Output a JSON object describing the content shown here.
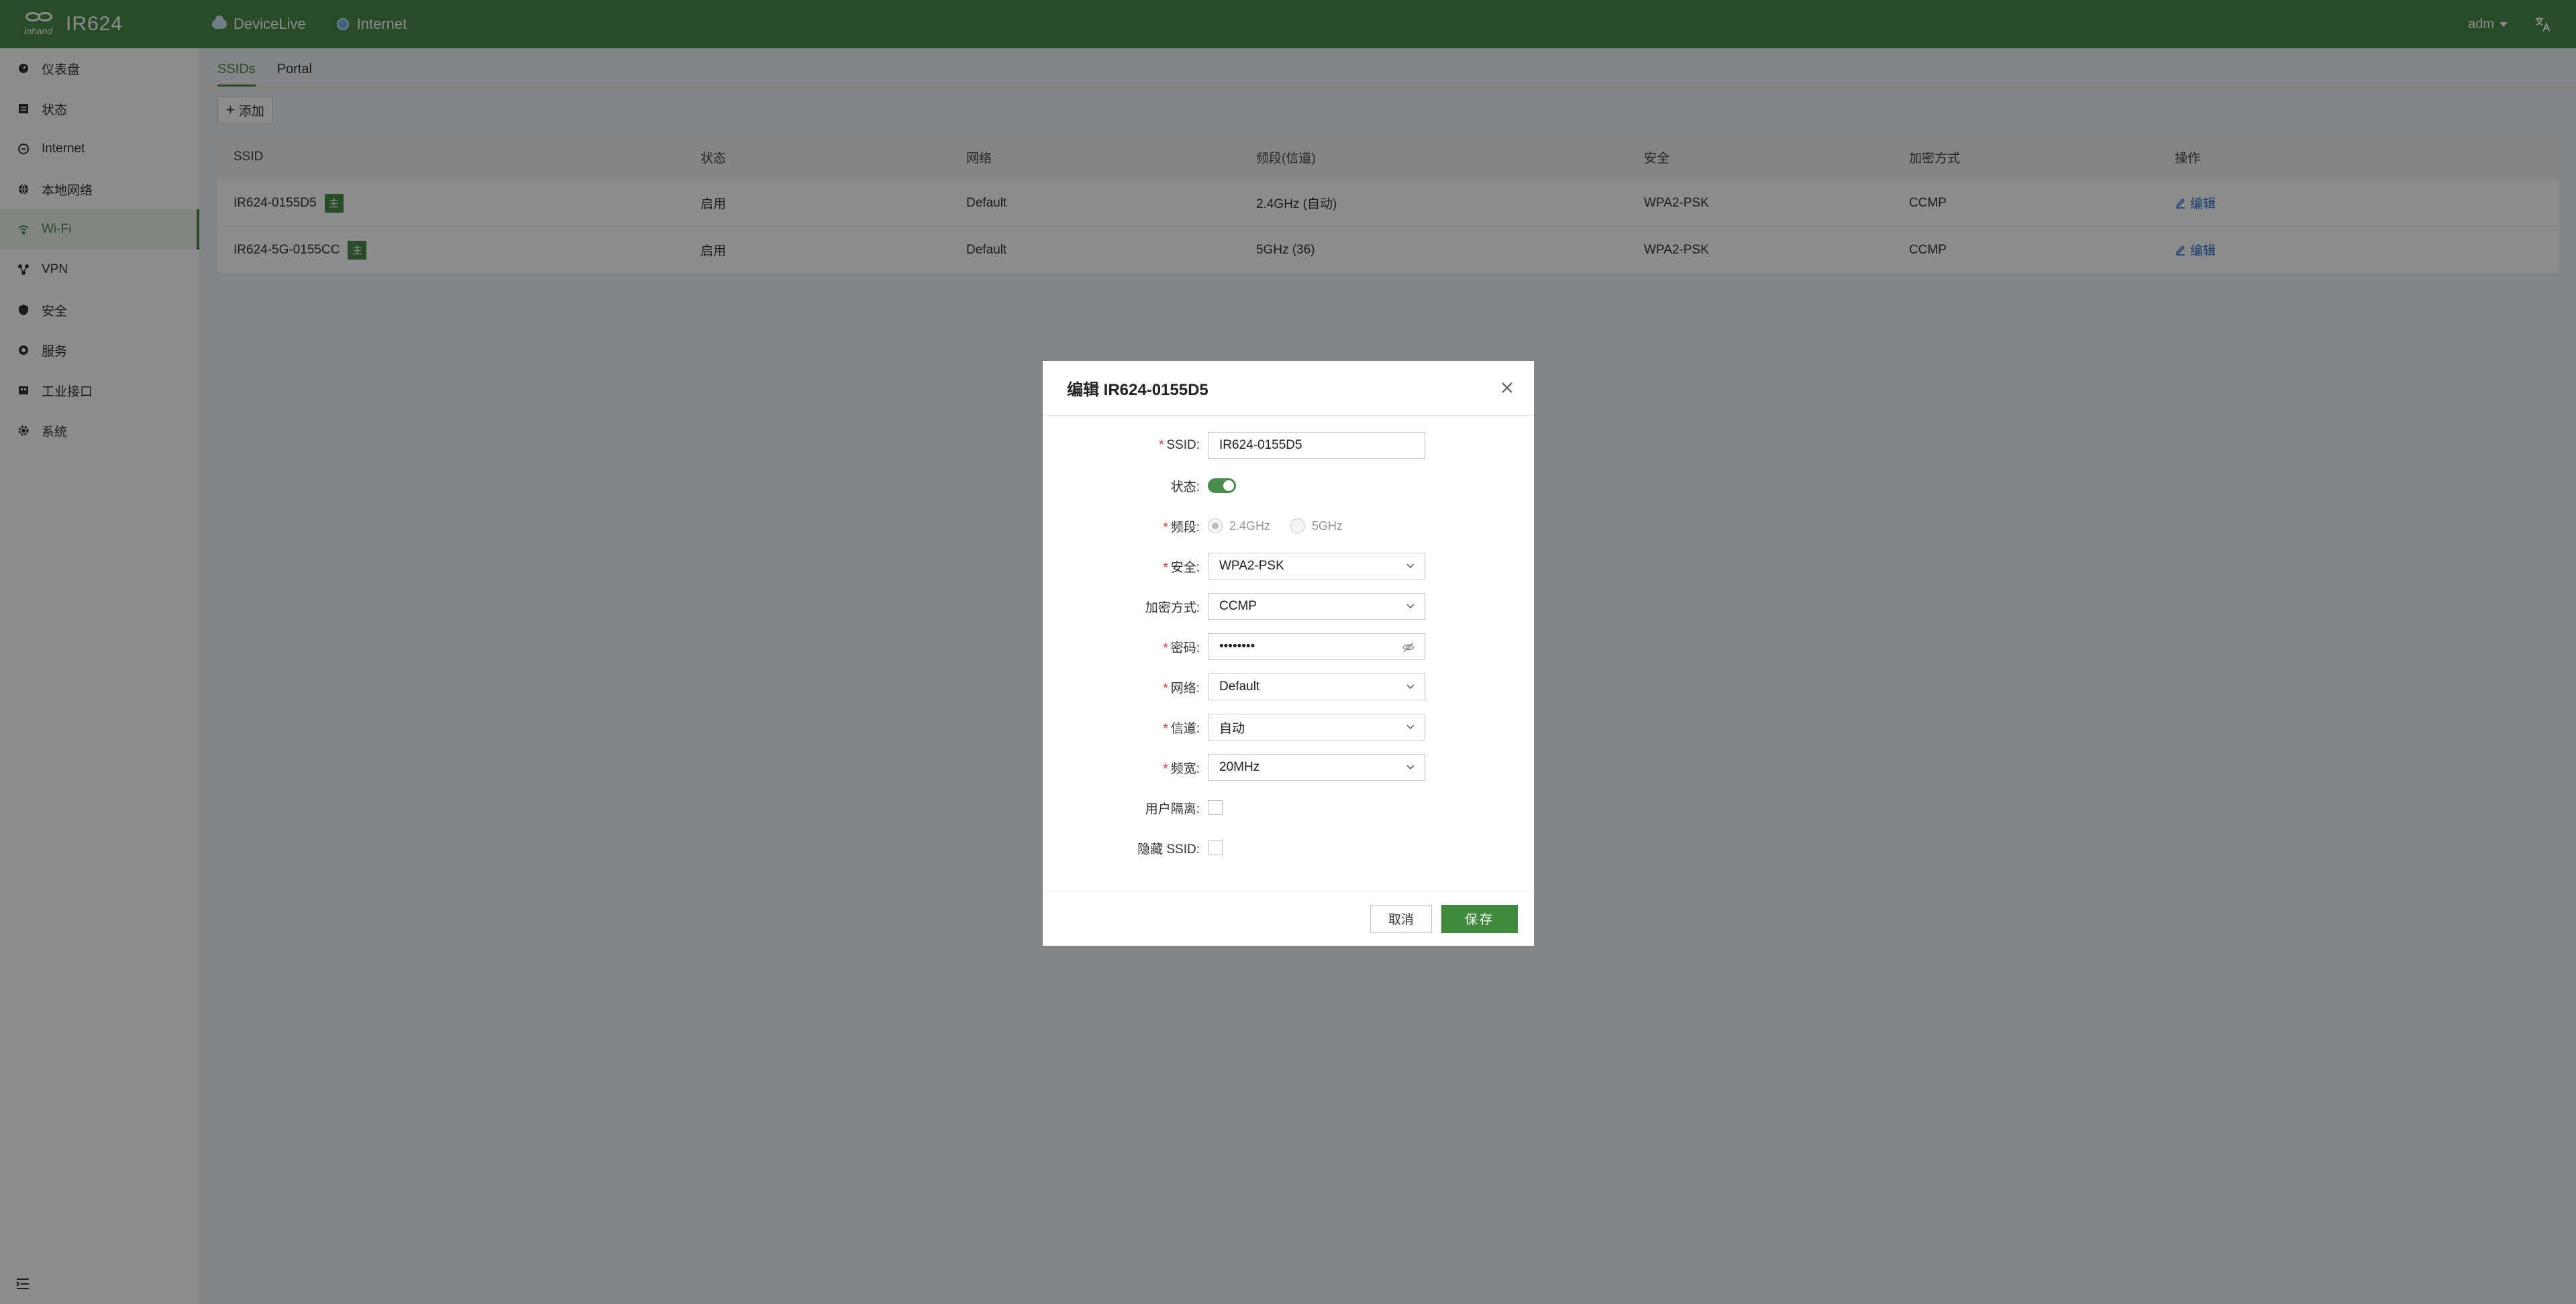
{
  "header": {
    "logo_small": "inhand",
    "product": "IR624",
    "status": [
      {
        "label": "DeviceLive",
        "icon": "cloud-icon"
      },
      {
        "label": "Internet",
        "icon": "globe-icon"
      }
    ],
    "user": "adm",
    "lang_icon": "translate-icon"
  },
  "sidebar": {
    "items": [
      {
        "label": "仪表盘",
        "icon": "dashboard-icon"
      },
      {
        "label": "状态",
        "icon": "status-icon"
      },
      {
        "label": "Internet",
        "icon": "internet-icon"
      },
      {
        "label": "本地网络",
        "icon": "lan-icon"
      },
      {
        "label": "Wi-Fi",
        "icon": "wifi-icon",
        "active": true
      },
      {
        "label": "VPN",
        "icon": "vpn-icon"
      },
      {
        "label": "安全",
        "icon": "shield-icon"
      },
      {
        "label": "服务",
        "icon": "service-icon"
      },
      {
        "label": "工业接口",
        "icon": "industrial-icon"
      },
      {
        "label": "系统",
        "icon": "gear-icon"
      }
    ]
  },
  "tabs": [
    {
      "label": "SSIDs",
      "active": true
    },
    {
      "label": "Portal",
      "active": false
    }
  ],
  "toolbar": {
    "add_label": "添加"
  },
  "table": {
    "headers": [
      "SSID",
      "状态",
      "网络",
      "频段(信道)",
      "安全",
      "加密方式",
      "操作"
    ],
    "rows": [
      {
        "ssid": "IR624-0155D5",
        "badge": "主",
        "status": "启用",
        "network": "Default",
        "band": "2.4GHz (自动)",
        "security": "WPA2-PSK",
        "encryption": "CCMP",
        "action": "编辑"
      },
      {
        "ssid": "IR624-5G-0155CC",
        "badge": "主",
        "status": "启用",
        "network": "Default",
        "band": "5GHz (36)",
        "security": "WPA2-PSK",
        "encryption": "CCMP",
        "action": "编辑"
      }
    ]
  },
  "modal": {
    "title": "编辑 IR624-0155D5",
    "labels": {
      "ssid": "SSID:",
      "status": "状态:",
      "band": "频段:",
      "security": "安全:",
      "encryption": "加密方式:",
      "password": "密码:",
      "network": "网络:",
      "channel": "信道:",
      "bandwidth": "频宽:",
      "isolation": "用户隔离:",
      "hidden": "隐藏 SSID:"
    },
    "values": {
      "ssid": "IR624-0155D5",
      "status_on": true,
      "band_options": [
        "2.4GHz",
        "5GHz"
      ],
      "band_selected": "2.4GHz",
      "security": "WPA2-PSK",
      "encryption": "CCMP",
      "password_masked": "••••••••",
      "network": "Default",
      "channel": "自动",
      "bandwidth": "20MHz",
      "isolation": false,
      "hidden": false
    },
    "cancel": "取消",
    "save": "保存"
  },
  "colors": {
    "brand": "#4a8a4a",
    "link": "#2b73d6",
    "required": "#e03030"
  }
}
